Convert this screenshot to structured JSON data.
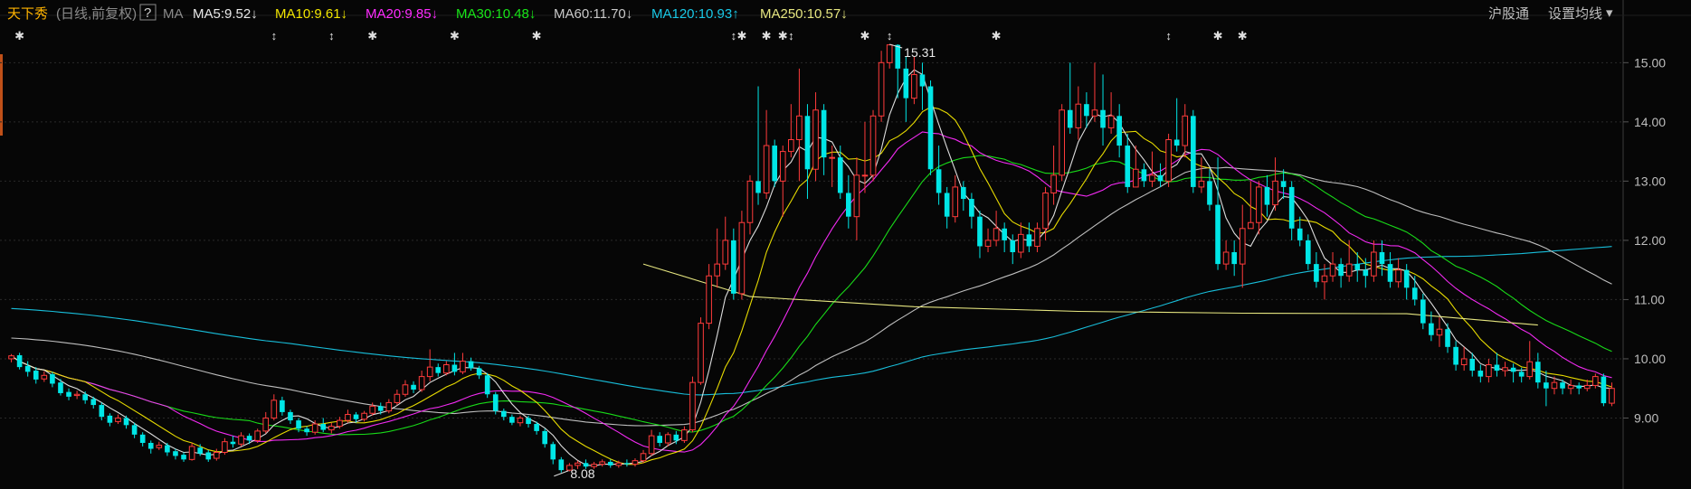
{
  "header": {
    "stock_name": "天下秀",
    "period_note": "(日线,前复权)",
    "help_glyph": "?",
    "ma_label": "MA",
    "ma_items": [
      {
        "label": "MA5:9.52",
        "arrow": "↓",
        "color": "#e8e8e8"
      },
      {
        "label": "MA10:9.61",
        "arrow": "↓",
        "color": "#f2e600"
      },
      {
        "label": "MA20:9.85",
        "arrow": "↓",
        "color": "#ff2cff"
      },
      {
        "label": "MA30:10.48",
        "arrow": "↓",
        "color": "#19e619"
      },
      {
        "label": "MA60:11.70",
        "arrow": "↓",
        "color": "#c8c8c8"
      },
      {
        "label": "MA120:10.93",
        "arrow": "↑",
        "color": "#19c8e6"
      },
      {
        "label": "MA250:10.57",
        "arrow": "↓",
        "color": "#e6e680"
      }
    ],
    "exchange_button": "沪股通",
    "settings_button": "设置均线",
    "settings_caret": "▾"
  },
  "chart_data": {
    "type": "candlestick",
    "y_axis": {
      "min": 8.0,
      "max": 15.6,
      "ticks": [
        9.0,
        10.0,
        11.0,
        12.0,
        13.0,
        14.0,
        15.0
      ],
      "tick_labels": [
        "9.00",
        "10.00",
        "11.00",
        "12.00",
        "13.00",
        "14.00",
        "15.00"
      ]
    },
    "grid": "horizontal-dotted",
    "colors": {
      "up": "#ff3b3b",
      "down": "#00e6e6",
      "background": "#060606",
      "grid": "#2a2a2a"
    },
    "annotations": [
      {
        "text": "15.31",
        "index": 107,
        "price": 15.31,
        "kind": "high"
      },
      {
        "text": "8.08",
        "index": 67,
        "price": 8.08,
        "kind": "low"
      }
    ],
    "event_markers": [
      {
        "index": 1,
        "glyph": "✱"
      },
      {
        "index": 32,
        "glyph": "↕"
      },
      {
        "index": 39,
        "glyph": "↕"
      },
      {
        "index": 44,
        "glyph": "✱"
      },
      {
        "index": 54,
        "glyph": "✱"
      },
      {
        "index": 64,
        "glyph": "✱"
      },
      {
        "index": 88,
        "glyph": "↕"
      },
      {
        "index": 89,
        "glyph": "✱"
      },
      {
        "index": 92,
        "glyph": "✱"
      },
      {
        "index": 94,
        "glyph": "✱"
      },
      {
        "index": 95,
        "glyph": "↕"
      },
      {
        "index": 104,
        "glyph": "✱"
      },
      {
        "index": 107,
        "glyph": "↕"
      },
      {
        "index": 120,
        "glyph": "✱"
      },
      {
        "index": 141,
        "glyph": "↕"
      },
      {
        "index": 147,
        "glyph": "✱"
      },
      {
        "index": 150,
        "glyph": "✱"
      }
    ],
    "candles": [
      [
        10.0,
        10.05,
        10.08,
        9.94
      ],
      [
        10.06,
        9.86,
        10.1,
        9.82
      ],
      [
        9.88,
        9.78,
        9.96,
        9.7
      ],
      [
        9.8,
        9.65,
        9.86,
        9.58
      ],
      [
        9.66,
        9.72,
        9.79,
        9.61
      ],
      [
        9.74,
        9.58,
        9.78,
        9.52
      ],
      [
        9.6,
        9.42,
        9.66,
        9.38
      ],
      [
        9.44,
        9.36,
        9.5,
        9.3
      ],
      [
        9.38,
        9.4,
        9.46,
        9.32
      ],
      [
        9.4,
        9.3,
        9.45,
        9.24
      ],
      [
        9.32,
        9.22,
        9.36,
        9.16
      ],
      [
        9.22,
        9.02,
        9.26,
        8.96
      ],
      [
        9.04,
        8.92,
        9.08,
        8.86
      ],
      [
        8.94,
        9.0,
        9.06,
        8.9
      ],
      [
        9.0,
        8.88,
        9.04,
        8.82
      ],
      [
        8.88,
        8.72,
        8.92,
        8.66
      ],
      [
        8.72,
        8.58,
        8.76,
        8.52
      ],
      [
        8.58,
        8.48,
        8.62,
        8.4
      ],
      [
        8.5,
        8.54,
        8.6,
        8.46
      ],
      [
        8.54,
        8.42,
        8.58,
        8.36
      ],
      [
        8.44,
        8.36,
        8.48,
        8.3
      ],
      [
        8.38,
        8.3,
        8.42,
        8.26
      ],
      [
        8.3,
        8.52,
        8.58,
        8.28
      ],
      [
        8.5,
        8.4,
        8.56,
        8.36
      ],
      [
        8.42,
        8.3,
        8.46,
        8.26
      ],
      [
        8.32,
        8.42,
        8.48,
        8.28
      ],
      [
        8.42,
        8.6,
        8.66,
        8.38
      ],
      [
        8.6,
        8.56,
        8.7,
        8.5
      ],
      [
        8.56,
        8.7,
        8.76,
        8.52
      ],
      [
        8.7,
        8.62,
        8.74,
        8.56
      ],
      [
        8.62,
        8.78,
        8.82,
        8.58
      ],
      [
        8.78,
        9.0,
        9.1,
        8.74
      ],
      [
        9.0,
        9.3,
        9.4,
        8.96
      ],
      [
        9.3,
        9.1,
        9.36,
        9.04
      ],
      [
        9.1,
        8.96,
        9.14,
        8.9
      ],
      [
        8.96,
        8.82,
        9.0,
        8.76
      ],
      [
        8.82,
        8.76,
        8.86,
        8.7
      ],
      [
        8.76,
        8.9,
        8.96,
        8.72
      ],
      [
        8.9,
        8.8,
        9.0,
        8.76
      ],
      [
        8.8,
        8.86,
        8.92,
        8.74
      ],
      [
        8.86,
        8.96,
        9.02,
        8.82
      ],
      [
        8.96,
        9.06,
        9.14,
        8.92
      ],
      [
        9.06,
        8.98,
        9.1,
        8.92
      ],
      [
        8.98,
        9.08,
        9.12,
        8.94
      ],
      [
        9.08,
        9.2,
        9.26,
        9.04
      ],
      [
        9.2,
        9.12,
        9.26,
        9.06
      ],
      [
        9.12,
        9.26,
        9.32,
        9.08
      ],
      [
        9.26,
        9.4,
        9.48,
        9.22
      ],
      [
        9.4,
        9.56,
        9.64,
        9.36
      ],
      [
        9.56,
        9.48,
        9.62,
        9.42
      ],
      [
        9.48,
        9.7,
        9.8,
        9.44
      ],
      [
        9.7,
        9.86,
        10.16,
        9.62
      ],
      [
        9.86,
        9.76,
        9.92,
        9.7
      ],
      [
        9.76,
        9.9,
        9.96,
        9.72
      ],
      [
        9.9,
        9.78,
        10.1,
        9.72
      ],
      [
        9.78,
        9.96,
        10.1,
        9.74
      ],
      [
        9.96,
        9.84,
        10.02,
        9.8
      ],
      [
        9.84,
        9.72,
        9.88,
        9.66
      ],
      [
        9.72,
        9.4,
        9.76,
        9.34
      ],
      [
        9.4,
        9.12,
        9.44,
        9.06
      ],
      [
        9.12,
        9.02,
        9.16,
        8.96
      ],
      [
        9.02,
        8.92,
        9.06,
        8.88
      ],
      [
        8.92,
        9.0,
        9.04,
        8.86
      ],
      [
        9.0,
        8.9,
        9.04,
        8.84
      ],
      [
        8.9,
        8.78,
        8.94,
        8.72
      ],
      [
        8.78,
        8.56,
        8.82,
        8.5
      ],
      [
        8.56,
        8.3,
        8.6,
        8.22
      ],
      [
        8.3,
        8.12,
        8.34,
        8.08
      ],
      [
        8.12,
        8.2,
        8.24,
        8.1
      ],
      [
        8.2,
        8.24,
        8.28,
        8.14
      ],
      [
        8.24,
        8.18,
        8.3,
        8.14
      ],
      [
        8.18,
        8.22,
        8.26,
        8.14
      ],
      [
        8.22,
        8.26,
        8.3,
        8.18
      ],
      [
        8.26,
        8.2,
        8.3,
        8.16
      ],
      [
        8.2,
        8.24,
        8.28,
        8.16
      ],
      [
        8.24,
        8.22,
        8.3,
        8.18
      ],
      [
        8.22,
        8.28,
        8.32,
        8.18
      ],
      [
        8.28,
        8.4,
        8.46,
        8.24
      ],
      [
        8.4,
        8.7,
        8.8,
        8.36
      ],
      [
        8.7,
        8.58,
        8.76,
        8.52
      ],
      [
        8.58,
        8.72,
        8.76,
        8.52
      ],
      [
        8.72,
        8.62,
        8.78,
        8.56
      ],
      [
        8.62,
        8.8,
        8.86,
        8.58
      ],
      [
        8.8,
        9.6,
        9.7,
        8.76
      ],
      [
        9.6,
        10.6,
        10.7,
        9.56
      ],
      [
        10.6,
        11.4,
        11.6,
        10.5
      ],
      [
        11.4,
        11.6,
        12.2,
        11.2
      ],
      [
        11.6,
        12.0,
        12.4,
        11.5
      ],
      [
        12.0,
        11.1,
        12.2,
        11.0
      ],
      [
        11.1,
        12.3,
        12.5,
        11.0
      ],
      [
        12.3,
        13.0,
        13.1,
        12.1
      ],
      [
        13.0,
        12.8,
        14.6,
        12.6
      ],
      [
        12.8,
        13.6,
        14.2,
        12.7
      ],
      [
        13.6,
        13.0,
        13.7,
        12.9
      ],
      [
        13.0,
        13.5,
        13.6,
        12.4
      ],
      [
        13.5,
        13.7,
        14.3,
        13.4
      ],
      [
        13.7,
        14.1,
        14.9,
        13.0
      ],
      [
        14.1,
        13.2,
        14.3,
        12.7
      ],
      [
        13.2,
        14.2,
        14.5,
        13.0
      ],
      [
        14.2,
        13.4,
        14.3,
        13.1
      ],
      [
        13.4,
        13.4,
        13.6,
        12.9
      ],
      [
        13.4,
        12.8,
        13.6,
        12.7
      ],
      [
        12.8,
        12.4,
        13.1,
        12.2
      ],
      [
        12.4,
        13.1,
        13.4,
        12.0
      ],
      [
        13.1,
        13.1,
        14.0,
        12.8
      ],
      [
        13.1,
        14.1,
        14.2,
        13.0
      ],
      [
        14.1,
        15.0,
        15.2,
        14.0
      ],
      [
        15.0,
        15.3,
        15.31,
        14.9
      ],
      [
        15.3,
        14.9,
        15.31,
        14.4
      ],
      [
        14.9,
        14.4,
        15.1,
        14.0
      ],
      [
        14.4,
        14.8,
        15.1,
        14.3
      ],
      [
        14.8,
        14.6,
        15.0,
        14.2
      ],
      [
        14.6,
        13.2,
        14.7,
        13.1
      ],
      [
        13.2,
        12.8,
        13.6,
        12.6
      ],
      [
        12.8,
        12.4,
        12.9,
        12.2
      ],
      [
        12.4,
        12.9,
        13.1,
        12.3
      ],
      [
        12.9,
        12.7,
        13.0,
        12.5
      ],
      [
        12.7,
        12.4,
        12.8,
        12.2
      ],
      [
        12.4,
        11.9,
        12.5,
        11.7
      ],
      [
        11.9,
        12.0,
        12.2,
        11.8
      ],
      [
        12.0,
        12.2,
        12.5,
        11.9
      ],
      [
        12.2,
        12.0,
        12.3,
        11.8
      ],
      [
        12.0,
        11.8,
        12.1,
        11.6
      ],
      [
        11.8,
        12.1,
        12.3,
        11.7
      ],
      [
        12.1,
        11.9,
        12.3,
        11.8
      ],
      [
        11.9,
        12.2,
        12.3,
        11.8
      ],
      [
        12.2,
        12.8,
        12.9,
        12.0
      ],
      [
        12.8,
        13.1,
        13.6,
        12.6
      ],
      [
        13.1,
        14.2,
        14.3,
        13.0
      ],
      [
        14.2,
        13.9,
        15.0,
        13.8
      ],
      [
        13.9,
        14.3,
        14.6,
        13.7
      ],
      [
        14.3,
        14.1,
        14.5,
        13.9
      ],
      [
        14.1,
        14.2,
        15.0,
        14.0
      ],
      [
        14.2,
        13.9,
        14.8,
        13.6
      ],
      [
        13.9,
        14.1,
        14.5,
        13.8
      ],
      [
        14.1,
        13.6,
        14.3,
        13.4
      ],
      [
        13.6,
        12.9,
        13.8,
        12.8
      ],
      [
        12.9,
        13.2,
        13.6,
        12.9
      ],
      [
        13.2,
        13.0,
        13.3,
        12.9
      ],
      [
        13.0,
        13.1,
        13.5,
        12.9
      ],
      [
        13.1,
        13.0,
        13.3,
        12.9
      ],
      [
        13.0,
        13.7,
        13.8,
        12.9
      ],
      [
        13.7,
        13.6,
        14.4,
        13.5
      ],
      [
        13.6,
        14.1,
        14.3,
        13.4
      ],
      [
        14.1,
        12.9,
        14.2,
        12.8
      ],
      [
        12.9,
        13.0,
        13.4,
        12.8
      ],
      [
        13.0,
        12.6,
        13.2,
        12.5
      ],
      [
        12.6,
        11.6,
        13.4,
        11.5
      ],
      [
        11.6,
        11.8,
        12.0,
        11.5
      ],
      [
        11.8,
        11.6,
        12.0,
        11.4
      ],
      [
        11.6,
        12.2,
        12.6,
        11.2
      ],
      [
        12.2,
        12.3,
        13.0,
        12.2
      ],
      [
        12.3,
        12.9,
        13.0,
        12.1
      ],
      [
        12.9,
        12.6,
        13.1,
        12.4
      ],
      [
        12.6,
        13.0,
        13.4,
        12.5
      ],
      [
        13.0,
        12.9,
        13.2,
        12.7
      ],
      [
        12.9,
        12.2,
        13.0,
        12.0
      ],
      [
        12.2,
        12.0,
        12.4,
        11.9
      ],
      [
        12.0,
        11.6,
        12.1,
        11.5
      ],
      [
        11.6,
        11.3,
        11.8,
        11.2
      ],
      [
        11.3,
        11.4,
        11.6,
        11.0
      ],
      [
        11.4,
        11.6,
        11.8,
        11.3
      ],
      [
        11.6,
        11.4,
        11.7,
        11.2
      ],
      [
        11.4,
        11.6,
        12.0,
        11.3
      ],
      [
        11.6,
        11.5,
        11.8,
        11.3
      ],
      [
        11.5,
        11.4,
        11.7,
        11.2
      ],
      [
        11.4,
        11.8,
        12.0,
        11.3
      ],
      [
        11.8,
        11.6,
        12.0,
        11.4
      ],
      [
        11.6,
        11.3,
        11.8,
        11.2
      ],
      [
        11.3,
        11.5,
        11.7,
        11.2
      ],
      [
        11.5,
        11.2,
        11.6,
        11.0
      ],
      [
        11.2,
        11.0,
        11.4,
        10.9
      ],
      [
        11.0,
        10.6,
        11.1,
        10.5
      ],
      [
        10.6,
        10.4,
        10.8,
        10.3
      ],
      [
        10.4,
        10.5,
        10.7,
        10.2
      ],
      [
        10.5,
        10.2,
        10.6,
        10.1
      ],
      [
        10.2,
        9.9,
        10.3,
        9.8
      ],
      [
        9.9,
        10.0,
        10.2,
        9.8
      ],
      [
        10.0,
        9.8,
        10.1,
        9.7
      ],
      [
        9.8,
        9.7,
        9.9,
        9.6
      ],
      [
        9.7,
        9.9,
        10.0,
        9.6
      ],
      [
        9.9,
        9.8,
        10.1,
        9.7
      ],
      [
        9.8,
        9.85,
        9.95,
        9.7
      ],
      [
        9.85,
        9.78,
        9.92,
        9.6
      ],
      [
        9.78,
        9.7,
        9.85,
        9.6
      ],
      [
        9.7,
        9.95,
        10.3,
        9.65
      ],
      [
        9.95,
        9.6,
        10.1,
        9.5
      ],
      [
        9.6,
        9.5,
        9.8,
        9.2
      ],
      [
        9.5,
        9.6,
        9.7,
        9.4
      ],
      [
        9.6,
        9.5,
        9.65,
        9.4
      ],
      [
        9.5,
        9.55,
        9.65,
        9.4
      ],
      [
        9.55,
        9.5,
        9.6,
        9.4
      ],
      [
        9.5,
        9.55,
        9.65,
        9.45
      ],
      [
        9.55,
        9.7,
        9.75,
        9.5
      ],
      [
        9.7,
        9.25,
        9.75,
        9.2
      ],
      [
        9.25,
        9.5,
        9.6,
        9.2
      ]
    ],
    "ma250_line": [
      [
        77,
        11.6
      ],
      [
        90,
        11.05
      ],
      [
        110,
        10.88
      ],
      [
        130,
        10.8
      ],
      [
        150,
        10.77
      ],
      [
        170,
        10.76
      ],
      [
        186,
        10.57
      ]
    ]
  }
}
